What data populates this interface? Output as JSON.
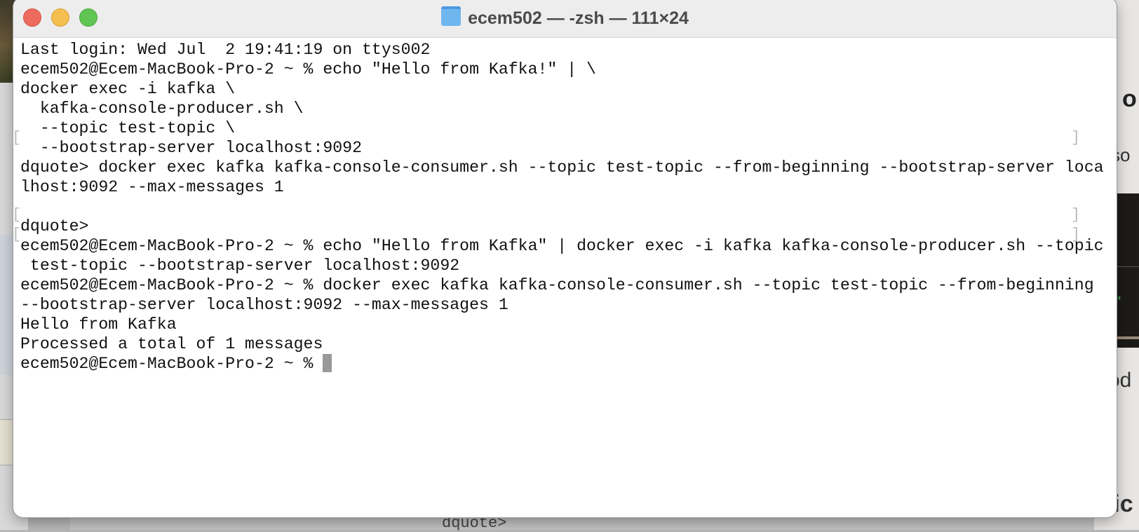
{
  "window": {
    "title": "ecem502 — -zsh — 111×24",
    "title_icon": "folder-icon"
  },
  "terminal": {
    "lines": [
      "Last login: Wed Jul  2 19:41:19 on ttys002",
      "ecem502@Ecem-MacBook-Pro-2 ~ % echo \"Hello from Kafka!\" | \\",
      "docker exec -i kafka \\",
      "  kafka-console-producer.sh \\",
      "  --topic test-topic \\",
      "  --bootstrap-server localhost:9092",
      "dquote> docker exec kafka kafka-console-consumer.sh --topic test-topic --from-beginning --bootstrap-server loca",
      "lhost:9092 --max-messages 1",
      "",
      "dquote>",
      "ecem502@Ecem-MacBook-Pro-2 ~ % echo \"Hello from Kafka\" | docker exec -i kafka kafka-console-producer.sh --topic",
      " test-topic --bootstrap-server localhost:9092",
      "ecem502@Ecem-MacBook-Pro-2 ~ % docker exec kafka kafka-console-consumer.sh --topic test-topic --from-beginning",
      "--bootstrap-server localhost:9092 --max-messages 1",
      "Hello from Kafka",
      "Processed a total of 1 messages"
    ],
    "prompt": "ecem502@Ecem-MacBook-Pro-2 ~ % "
  },
  "background": {
    "right_texts": [
      "o",
      "so",
      "od",
      "tic"
    ],
    "bottom_text": "dquote>"
  }
}
